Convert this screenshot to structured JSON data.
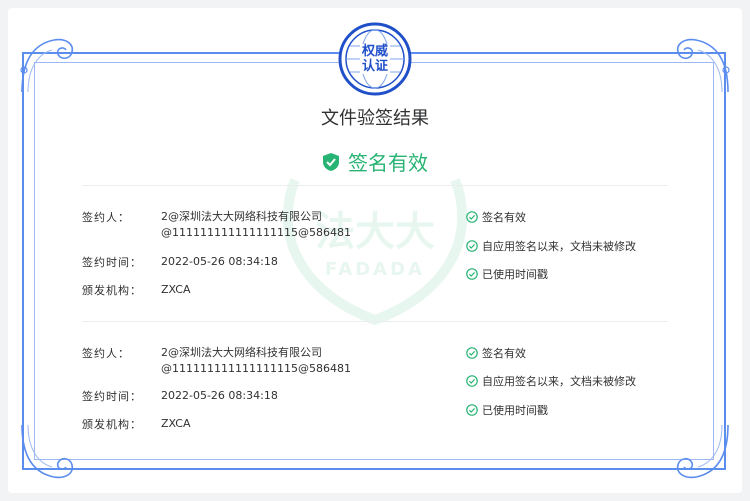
{
  "seal": {
    "line1": "权威",
    "line2": "认证"
  },
  "document": {
    "title": "文件验签结果"
  },
  "status": {
    "text": "签名有效",
    "color": "#27b373"
  },
  "watermark": {
    "text": "法大大",
    "sub": "FADADA"
  },
  "signatures": [
    {
      "signer_label": "签约人：",
      "signer_line1": "2@深圳法大大网络科技有限公司",
      "signer_line2": "@111111111111111115@586481",
      "time_label": "签约时间：",
      "time_value": "2022-05-26 08:34:18",
      "issuer_label": "颁发机构：",
      "issuer_value": "ZXCA",
      "checks": [
        "签名有效",
        "自应用签名以来，文档未被修改",
        "已使用时间戳"
      ]
    },
    {
      "signer_label": "签约人：",
      "signer_line1": "2@深圳法大大网络科技有限公司",
      "signer_line2": "@111111111111111115@586481",
      "time_label": "签约时间：",
      "time_value": "2022-05-26 08:34:18",
      "issuer_label": "颁发机构：",
      "issuer_value": "ZXCA",
      "checks": [
        "签名有效",
        "自应用签名以来，文档未被修改",
        "已使用时间戳"
      ]
    }
  ],
  "colors": {
    "frame": "#5b8def",
    "accent": "#27b373",
    "text": "#303133"
  }
}
